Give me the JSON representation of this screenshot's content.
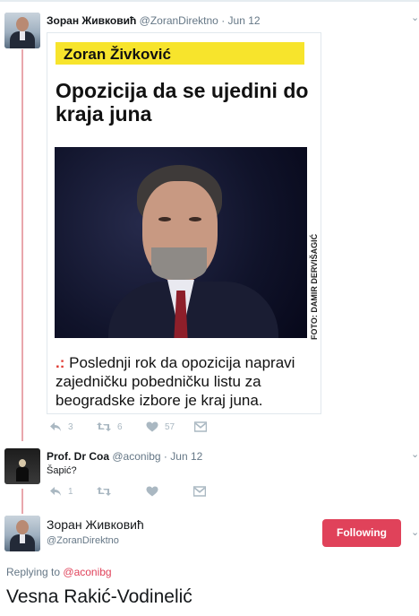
{
  "tweet1": {
    "author_name": "Зоран Живковић",
    "author_handle": "@ZoranDirektno",
    "separator": "·",
    "time": "Jun 12",
    "card": {
      "name_banner": "Zoran Živković",
      "headline": "Opozicija da se ujedini do kraja juna",
      "photo_credit": "FOTO: DAMIR DERVIŠAGIĆ",
      "lead_mark": ".:",
      "lead_text": "Poslednji rok da opozicija napravi zajedničku pobedničku listu za beogradske izbore je kraj juna."
    },
    "actions": {
      "reply_count": "3",
      "retweet_count": "6",
      "like_count": "57"
    }
  },
  "tweet2": {
    "author_name": "Prof. Dr Coa",
    "author_handle": "@aconibg",
    "separator": "·",
    "time": "Jun 12",
    "text": "Šapić?",
    "actions": {
      "reply_count": "1"
    }
  },
  "tweet3": {
    "author_name": "Зоран Живковић",
    "author_handle": "@ZoranDirektno",
    "follow_label": "Following",
    "replying_prefix": "Replying to",
    "replying_handle": "@aconibg",
    "text": "Vesna Rakić-Vodinelić"
  },
  "colors": {
    "thread_line": "#e9a7ac",
    "following_button": "#e0425a",
    "banner_yellow": "#f7e42c"
  },
  "icons": [
    "reply-icon",
    "retweet-icon",
    "like-icon",
    "direct-message-icon",
    "chevron-down-icon"
  ]
}
